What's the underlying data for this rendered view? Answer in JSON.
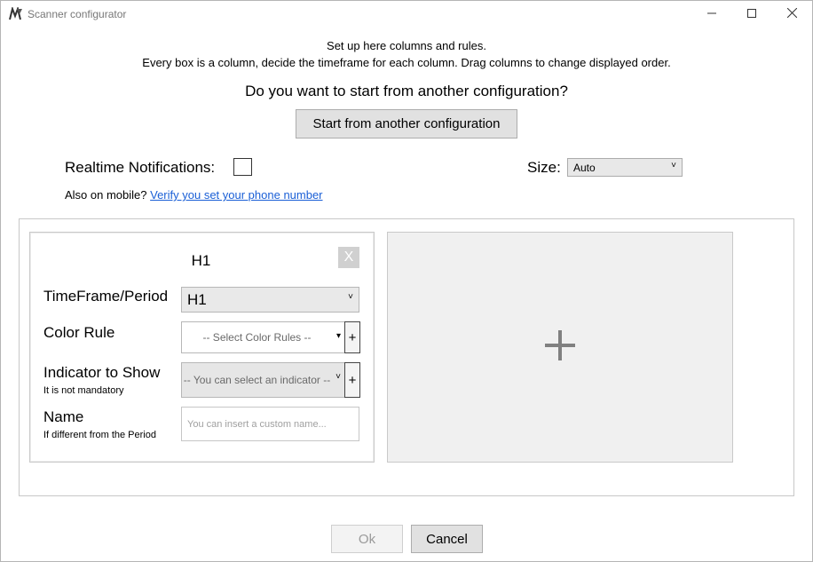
{
  "window": {
    "title": "Scanner configurator",
    "icon": "app-logo-icon",
    "minimize_icon": "minimize-icon",
    "maximize_icon": "maximize-icon",
    "close_icon": "close-icon"
  },
  "intro": {
    "line1": "Set up here columns and rules.",
    "line2": "Every box is a column, decide the timeframe for each column. Drag columns to change displayed order.",
    "question": "Do you want to start from another configuration?",
    "start_button": "Start from another configuration"
  },
  "options": {
    "realtime_label": "Realtime Notifications:",
    "realtime_checked": false,
    "size_label": "Size:",
    "size_value": "Auto",
    "mobile_prefix": "Also on mobile?",
    "mobile_link": "Verify you set your phone number"
  },
  "column": {
    "title": "H1",
    "close_label": "X",
    "timeframe_label": "TimeFrame/Period",
    "timeframe_value": "H1",
    "color_rule_label": "Color Rule",
    "color_rule_placeholder": "-- Select Color Rules --",
    "indicator_label": "Indicator to Show",
    "indicator_sub": "It is not mandatory",
    "indicator_placeholder": "-- You can select an indicator --",
    "name_label": "Name",
    "name_sub": "If different from the Period",
    "name_placeholder": "You can insert a custom name...",
    "add_symbol": "+"
  },
  "add_column": {
    "icon": "plus-icon"
  },
  "footer": {
    "ok_label": "Ok",
    "cancel_label": "Cancel"
  },
  "colors": {
    "link": "#1a5fd6",
    "button_bg": "#e1e1e1",
    "add_column_bg": "#f0f0f0"
  }
}
